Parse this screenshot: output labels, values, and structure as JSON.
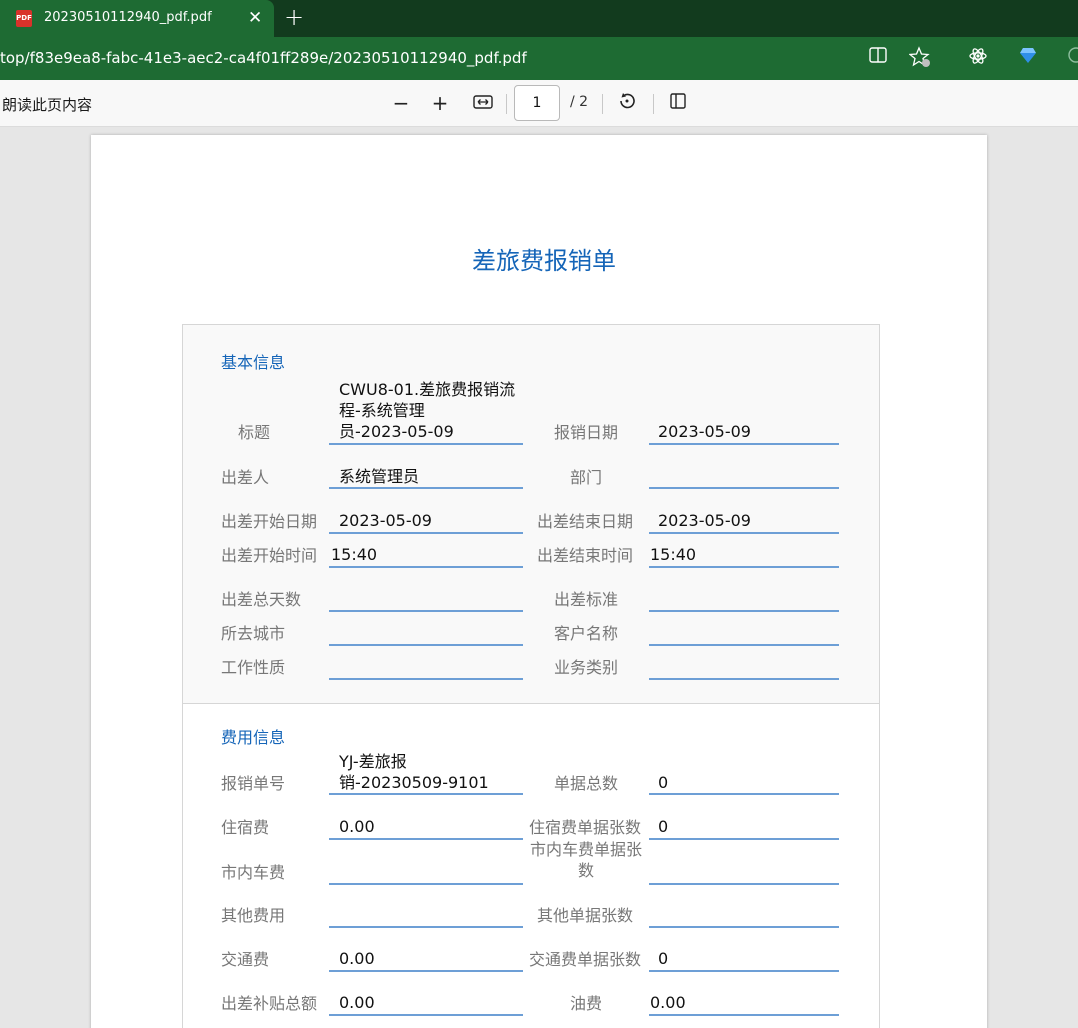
{
  "browser": {
    "tab_title": "20230510112940_pdf.pdf",
    "tab_icon": "pdf-file-icon",
    "url": "top/f83e9ea8-fabc-41e3-aec2-ca4f01ff289e/20230510112940_pdf.pdf",
    "colors": {
      "tabbar": "#123b1e",
      "active_tab": "#1e6b33"
    }
  },
  "toolbar": {
    "read_aloud": "朗读此页内容",
    "zoom_out": "−",
    "zoom_in": "+",
    "page_number": "1",
    "page_total": "/ 2"
  },
  "document": {
    "title": "差旅费报销单",
    "sections": {
      "basic": {
        "heading": "基本信息",
        "title_label": "标题",
        "title_value_lines": [
          "CWU8-01.差旅费报销流",
          "程-系统管理",
          "员-2023-05-09"
        ],
        "report_date_label": "报销日期",
        "report_date_value": "2023-05-09",
        "traveler_label": "出差人",
        "traveler_value": "系统管理员",
        "dept_label": "部门",
        "dept_value": "",
        "start_date_label": "出差开始日期",
        "start_date_value": "2023-05-09",
        "end_date_label": "出差结束日期",
        "end_date_value": "2023-05-09",
        "start_time_label": "出差开始时间",
        "start_time_value": "15:40",
        "end_time_label": "出差结束时间",
        "end_time_value": "15:40",
        "total_days_label": "出差总天数",
        "standard_label": "出差标准",
        "city_label": "所去城市",
        "customer_label": "客户名称",
        "work_nature_label": "工作性质",
        "biz_type_label": "业务类别"
      },
      "expense": {
        "heading": "费用信息",
        "report_no_label": "报销单号",
        "report_no_lines": [
          "YJ-差旅报",
          "销-20230509-9101"
        ],
        "doc_total_label": "单据总数",
        "doc_total_value": "0",
        "lodging_label": "住宿费",
        "lodging_value": "0.00",
        "lodging_docs_label": "住宿费单据张数",
        "lodging_docs_value": "0",
        "local_fare_label": "市内车费",
        "local_fare_docs_label_lines": [
          "市内车费单据张",
          "数"
        ],
        "other_fee_label": "其他费用",
        "other_docs_label": "其他单据张数",
        "transport_label": "交通费",
        "transport_value": "0.00",
        "transport_docs_label": "交通费单据张数",
        "transport_docs_value": "0",
        "allowance_label": "出差补贴总额",
        "allowance_value": "0.00",
        "fuel_label": "油费",
        "fuel_value": "0.00"
      }
    }
  }
}
